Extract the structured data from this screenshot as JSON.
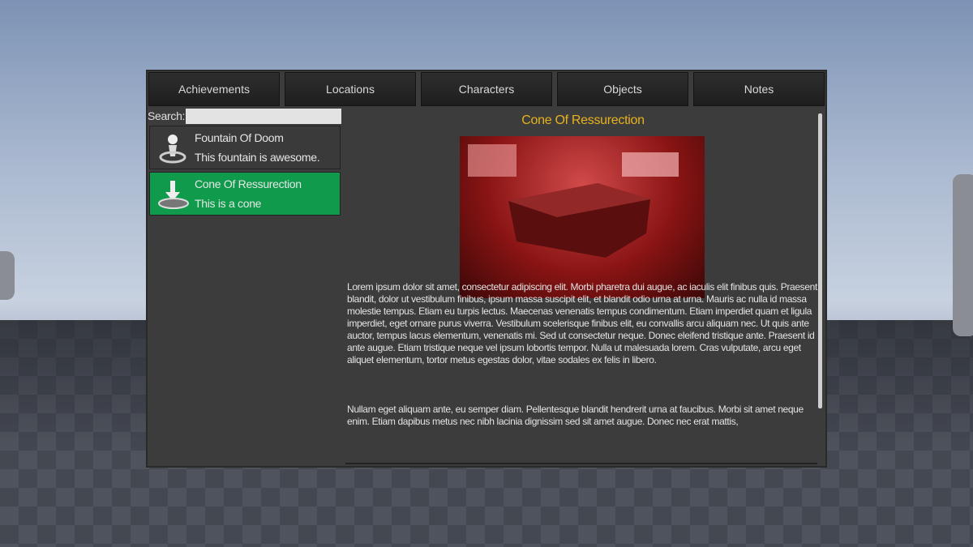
{
  "tabs": [
    "Achievements",
    "Locations",
    "Characters",
    "Objects",
    "Notes"
  ],
  "search": {
    "label": "Search:",
    "value": "",
    "placeholder": ""
  },
  "list": [
    {
      "title": "Fountain Of Doom",
      "desc": "This fountain is awesome.",
      "icon": "person-on-pedestal-icon",
      "selected": false
    },
    {
      "title": "Cone Of Ressurection",
      "desc": "This is a cone",
      "icon": "download-arrow-icon",
      "selected": true
    }
  ],
  "detail": {
    "title": "Cone Of Ressurection",
    "paragraphs": [
      "Lorem ipsum dolor sit amet, consectetur adipiscing elit. Morbi pharetra dui augue, ac iaculis elit finibus quis. Praesent blandit, dolor ut vestibulum finibus, ipsum massa suscipit elit, et blandit odio urna at urna. Mauris ac nulla id massa molestie tempus. Etiam eu turpis lectus. Maecenas venenatis tempus condimentum. Etiam imperdiet quam et ligula imperdiet, eget ornare purus viverra. Vestibulum scelerisque finibus elit, eu convallis arcu aliquam nec. Ut quis ante auctor, tempus lacus elementum, venenatis mi. Sed ut consectetur neque. Donec eleifend tristique ante. Praesent id ante augue. Etiam tristique neque vel ipsum lobortis tempor. Nulla ut malesuada lorem. Cras vulputate, arcu eget aliquet elementum, tortor metus egestas dolor, vitae sodales ex felis in libero.",
      "Nullam eget aliquam ante, eu semper diam. Pellentesque blandit hendrerit urna at faucibus. Morbi sit amet neque enim. Etiam dapibus metus nec nibh lacinia dignissim sed sit amet augue. Donec nec erat mattis,"
    ]
  },
  "colors": {
    "accent_title": "#e8b21d",
    "selected_item": "#0f9a4c",
    "panel": "#3c3c3c"
  }
}
